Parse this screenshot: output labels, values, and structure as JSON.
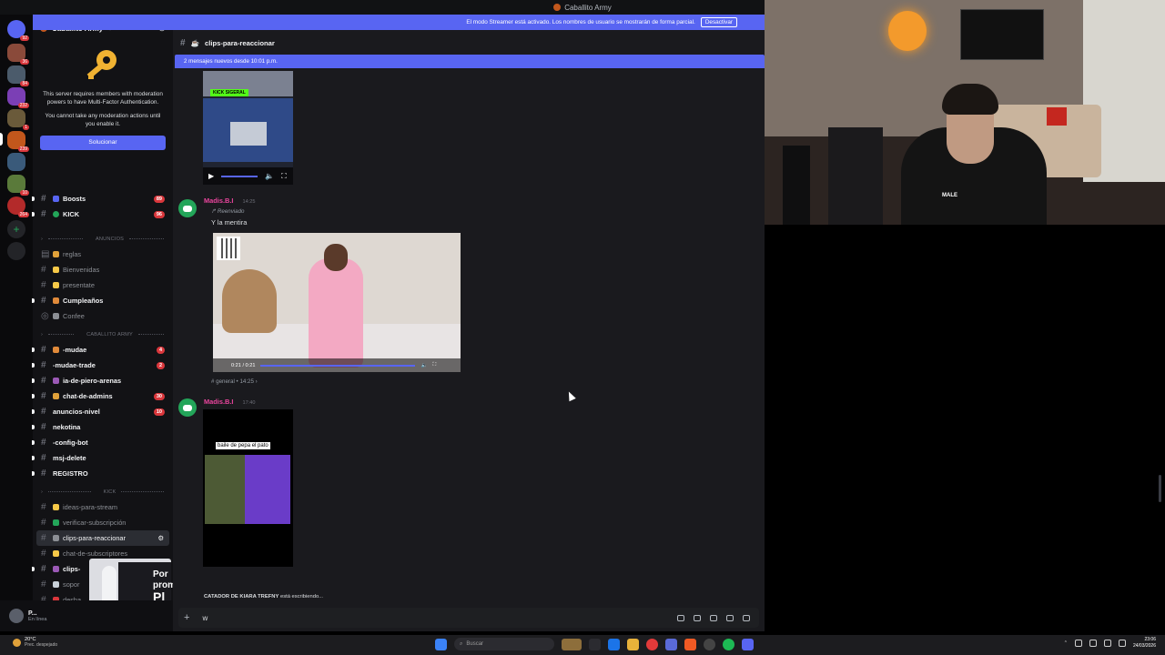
{
  "window": {
    "title": "Caballito Army"
  },
  "banner": {
    "text": "El modo Streamer está activado. Los nombres de usuario se mostrarán de forma parcial.",
    "button": "Desactivar"
  },
  "server": {
    "name": "Caballito Army",
    "mfa_text_1": "This server requires members with moderation powers to have Multi-Factor Authentication.",
    "mfa_text_2": "You cannot take any moderation actions until you enable it.",
    "fix_button": "Solucionar"
  },
  "rail_badges": [
    "92",
    "36",
    "84",
    "232",
    "1",
    "239",
    "10",
    "264"
  ],
  "channels_top": [
    {
      "label": "Boosts",
      "badge": "89",
      "color": "#5865f2"
    },
    {
      "label": "KICK",
      "badge": "96",
      "color": "#23a559"
    }
  ],
  "categories": {
    "anuncios": "ANUNCIOS",
    "caballito": "CABALLITO ARMY",
    "kick": "KICK"
  },
  "channels_anuncios": [
    {
      "label": "reglas",
      "color": "#e0a13a",
      "unread": false
    },
    {
      "label": "Bienvenidas",
      "color": "#f7c948",
      "unread": false
    },
    {
      "label": "presentate",
      "color": "#f7c948",
      "unread": false
    },
    {
      "label": "Cumpleaños",
      "color": "#e08a3a",
      "unread": true
    },
    {
      "label": "Confee",
      "color": "#8c8f95",
      "unread": false
    }
  ],
  "channels_caballito": [
    {
      "label": "-mudae",
      "badge": "4",
      "color": "#e08a3a"
    },
    {
      "label": "-mudae-trade",
      "badge": "2",
      "color": ""
    },
    {
      "label": "ia-de-piero-arenas",
      "badge": "",
      "color": "#9b59b6"
    },
    {
      "label": "chat-de-admins",
      "badge": "30",
      "color": "#e0a13a"
    },
    {
      "label": "anuncios-nivel",
      "badge": "10",
      "color": ""
    },
    {
      "label": "nekotina",
      "badge": "",
      "color": ""
    },
    {
      "label": "-config-bot",
      "badge": "",
      "color": ""
    },
    {
      "label": "msj-delete",
      "badge": "",
      "color": ""
    },
    {
      "label": "REGISTRO",
      "badge": "",
      "color": ""
    }
  ],
  "channels_kick": [
    {
      "label": "ideas-para-stream",
      "color": "#f7c948",
      "state": "muted"
    },
    {
      "label": "verificar-subscripción",
      "color": "#23a559",
      "state": "muted"
    },
    {
      "label": "clips-para-reaccionar",
      "color": "#8c8f95",
      "state": "active"
    },
    {
      "label": "chat-de-subscriptores",
      "color": "#f7c948",
      "state": "muted"
    },
    {
      "label": "clips-",
      "color": "#9b59b6",
      "state": "unread"
    },
    {
      "label": "sopor",
      "color": "#c9d1d9",
      "state": "muted"
    },
    {
      "label": "desba",
      "color": "#da373c",
      "state": "muted"
    }
  ],
  "user": {
    "name": "P...",
    "status": "En línea"
  },
  "overlay": {
    "text_top": "Por",
    "text_mid": "prom",
    "text_bot": "Pl"
  },
  "channel": {
    "name": "clips-para-reaccionar",
    "new_messages": "2 mensajes nuevos desde 10:01 p.m."
  },
  "messages": [
    {
      "author": "Madis.B.I",
      "time": "14:25",
      "forwarded": "Reenviado",
      "text": "Y la mentira",
      "video_time": "0:21 / 0:21",
      "source": "general",
      "source_time": "14:25"
    },
    {
      "author": "Madis.B.I",
      "time": "17:40",
      "caption": "baile de pepa el pato"
    }
  ],
  "video1": {
    "kick_label": "KICK SIGERAL"
  },
  "typing": {
    "who": "CATADOR DE KIARA TREFNY",
    "rest": "está escribiendo..."
  },
  "composer": {
    "value": "w"
  },
  "taskbar": {
    "temp": "20°C",
    "weather": "Prec. despejado",
    "search": "Buscar",
    "time": "23:06",
    "date": "24/03/2026"
  },
  "cam": {
    "shirt_text": "MALE"
  }
}
